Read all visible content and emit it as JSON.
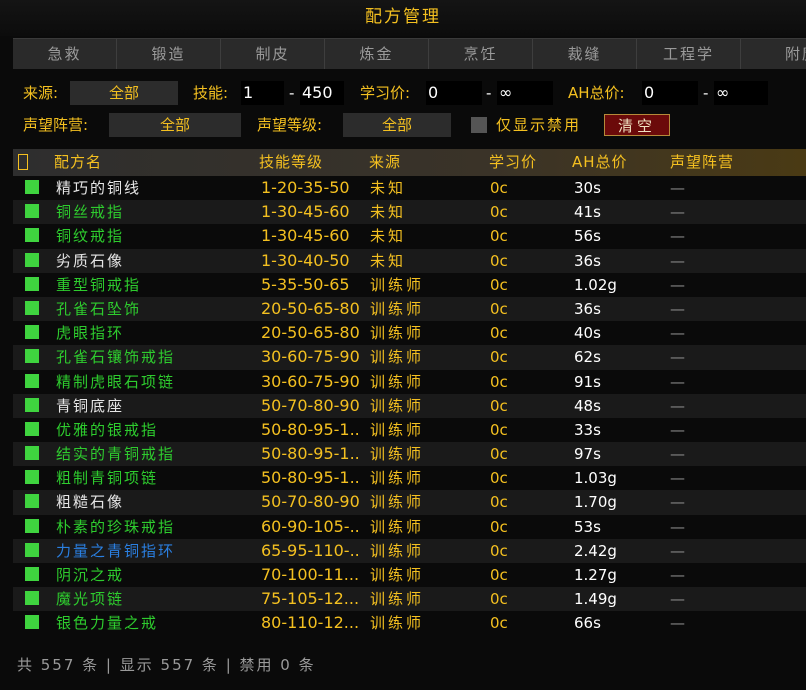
{
  "window": {
    "title": "配方管理"
  },
  "tabs": [
    "急救",
    "锻造",
    "制皮",
    "炼金",
    "烹饪",
    "裁缝",
    "工程学",
    "附魔"
  ],
  "filters": {
    "source_label": "来源:",
    "source_value": "全部",
    "skill_label": "技能:",
    "skill_min": "1",
    "skill_sep": "-",
    "skill_max": "450",
    "learn_label": "学习价:",
    "learn_min": "0",
    "learn_sep": "-",
    "learn_max": "∞",
    "ah_label": "AH总价:",
    "ah_min": "0",
    "ah_sep": "-",
    "ah_max": "∞",
    "faction_label": "声望阵营:",
    "faction_value": "全部",
    "replevel_label": "声望等级:",
    "replevel_value": "全部",
    "disabled_only_label": "仅显示禁用",
    "clear_button": "清空"
  },
  "table": {
    "headers": {
      "name": "配方名",
      "skill": "技能等级",
      "source": "来源",
      "learn": "学习价",
      "ah": "AH总价",
      "rep": "声望阵营"
    },
    "rows": [
      {
        "name": "精巧的铜线",
        "color": "#e6e6e6",
        "skill": "1-20-35-50",
        "source": "未知",
        "learn": "0c",
        "ah": "30s",
        "rep": "—"
      },
      {
        "name": "铜丝戒指",
        "color": "#2ecc2e",
        "skill": "1-30-45-60",
        "source": "未知",
        "learn": "0c",
        "ah": "41s",
        "rep": "—"
      },
      {
        "name": "铜纹戒指",
        "color": "#2ecc2e",
        "skill": "1-30-45-60",
        "source": "未知",
        "learn": "0c",
        "ah": "56s",
        "rep": "—"
      },
      {
        "name": "劣质石像",
        "color": "#e6e6e6",
        "skill": "1-30-40-50",
        "source": "未知",
        "learn": "0c",
        "ah": "36s",
        "rep": "—"
      },
      {
        "name": "重型铜戒指",
        "color": "#2ecc2e",
        "skill": "5-35-50-65",
        "source": "训练师",
        "learn": "0c",
        "ah": "1.02g",
        "rep": "—"
      },
      {
        "name": "孔雀石坠饰",
        "color": "#2ecc2e",
        "skill": "20-50-65-80",
        "source": "训练师",
        "learn": "0c",
        "ah": "36s",
        "rep": "—"
      },
      {
        "name": "虎眼指环",
        "color": "#2ecc2e",
        "skill": "20-50-65-80",
        "source": "训练师",
        "learn": "0c",
        "ah": "40s",
        "rep": "—"
      },
      {
        "name": "孔雀石镶饰戒指",
        "color": "#2ecc2e",
        "skill": "30-60-75-90",
        "source": "训练师",
        "learn": "0c",
        "ah": "62s",
        "rep": "—"
      },
      {
        "name": "精制虎眼石项链",
        "color": "#2ecc2e",
        "skill": "30-60-75-90",
        "source": "训练师",
        "learn": "0c",
        "ah": "91s",
        "rep": "—"
      },
      {
        "name": "青铜底座",
        "color": "#e6e6e6",
        "skill": "50-70-80-90",
        "source": "训练师",
        "learn": "0c",
        "ah": "48s",
        "rep": "—"
      },
      {
        "name": "优雅的银戒指",
        "color": "#2ecc2e",
        "skill": "50-80-95-1...",
        "source": "训练师",
        "learn": "0c",
        "ah": "33s",
        "rep": "—"
      },
      {
        "name": "结实的青铜戒指",
        "color": "#2ecc2e",
        "skill": "50-80-95-1...",
        "source": "训练师",
        "learn": "0c",
        "ah": "97s",
        "rep": "—"
      },
      {
        "name": "粗制青铜项链",
        "color": "#2ecc2e",
        "skill": "50-80-95-1...",
        "source": "训练师",
        "learn": "0c",
        "ah": "1.03g",
        "rep": "—"
      },
      {
        "name": "粗糙石像",
        "color": "#e6e6e6",
        "skill": "50-70-80-90",
        "source": "训练师",
        "learn": "0c",
        "ah": "1.70g",
        "rep": "—"
      },
      {
        "name": "朴素的珍珠戒指",
        "color": "#2ecc2e",
        "skill": "60-90-105-...",
        "source": "训练师",
        "learn": "0c",
        "ah": "53s",
        "rep": "—"
      },
      {
        "name": "力量之青铜指环",
        "color": "#2a7fe0",
        "skill": "65-95-110-...",
        "source": "训练师",
        "learn": "0c",
        "ah": "2.42g",
        "rep": "—"
      },
      {
        "name": "阴沉之戒",
        "color": "#2ecc2e",
        "skill": "70-100-11...",
        "source": "训练师",
        "learn": "0c",
        "ah": "1.27g",
        "rep": "—"
      },
      {
        "name": "魔光项链",
        "color": "#2ecc2e",
        "skill": "75-105-12...",
        "source": "训练师",
        "learn": "0c",
        "ah": "1.49g",
        "rep": "—"
      },
      {
        "name": "银色力量之戒",
        "color": "#2ecc2e",
        "skill": "80-110-12...",
        "source": "训练师",
        "learn": "0c",
        "ah": "66s",
        "rep": "—"
      }
    ]
  },
  "footer": {
    "text": "共 557 条 | 显示 557 条 | 禁用 0 条"
  },
  "colors": {
    "accent": "#f4c020",
    "green": "#2ecc2e",
    "blue": "#2a7fe0",
    "white": "#e6e6e6",
    "clear_button_bg": "#6b0a0a"
  },
  "icons": {
    "row_checkbox": "checked-square-icon"
  }
}
